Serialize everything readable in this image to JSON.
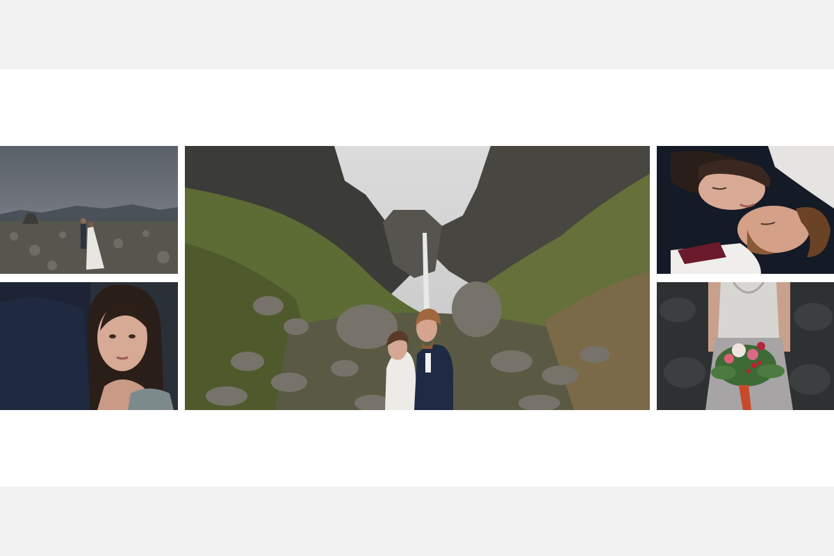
{
  "album": {
    "background_color": "#f2f2f2",
    "spread_color": "#ffffff",
    "photos": [
      {
        "subject": "couple-on-lava-field"
      },
      {
        "subject": "bride-portrait"
      },
      {
        "subject": "couple-kissing-at-waterfall-canyon"
      },
      {
        "subject": "couple-lying-faces-together"
      },
      {
        "subject": "bride-holding-bouquet"
      }
    ]
  }
}
